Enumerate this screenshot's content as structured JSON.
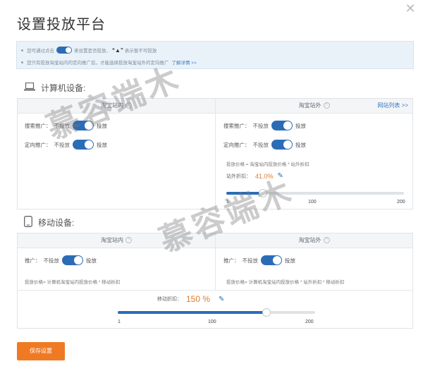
{
  "dialog": {
    "title": "设置投放平台",
    "close_icon": "close-icon"
  },
  "tips": {
    "line1_a": "您可通过点击",
    "line1_b": "来设置是否投放，",
    "line1_c": "表示暂不可投放",
    "line2": "您只有投放淘宝站内的定向推广后，才能选择投放淘宝站外的定向推广",
    "learn_more": "了解详情 >>"
  },
  "pc": {
    "section_title": "计算机设备:",
    "inside": {
      "header": "淘宝站内",
      "row1_label": "搜索推广：",
      "row1_off": "不投放",
      "row1_on": "投放",
      "row2_label": "定向推广：",
      "row2_off": "不投放",
      "row2_on": "投放"
    },
    "outside": {
      "header": "淘宝站外",
      "site_list": "网站列表 >>",
      "row1_label": "搜索推广：",
      "row1_off": "不投放",
      "row1_on": "投放",
      "row2_label": "定向推广：",
      "row2_off": "不投放",
      "row2_on": "投放",
      "formula": "投放价格 = 淘宝站内投放价格 * 站外折扣",
      "discount_label": "站外折扣：",
      "discount_value": "41.0%",
      "discount_pct": 41,
      "slider_min": "1",
      "slider_mid": "100",
      "slider_max": "200"
    }
  },
  "mobile": {
    "section_title": "移动设备:",
    "inside": {
      "header": "淘宝站内",
      "row_label": "推广：",
      "row_off": "不投放",
      "row_on": "投放",
      "formula": "投放价格= 计算机淘宝站内投放价格 * 移动折扣"
    },
    "outside": {
      "header": "淘宝站外",
      "row_label": "推广：",
      "row_off": "不投放",
      "row_on": "投放",
      "formula": "投放价格= 计算机淘宝站内投放价格 * 站外折扣 * 移动折扣"
    },
    "discount_label": "移动折扣：",
    "discount_value": "150 %",
    "discount_pct": 150,
    "slider_min": "1",
    "slider_mid": "100",
    "slider_max": "200"
  },
  "save_button": "保存设置",
  "watermark": "慕容端木",
  "colors": {
    "accent": "#2b6cb7",
    "save": "#f07a24",
    "discount": "#e07b2c"
  }
}
